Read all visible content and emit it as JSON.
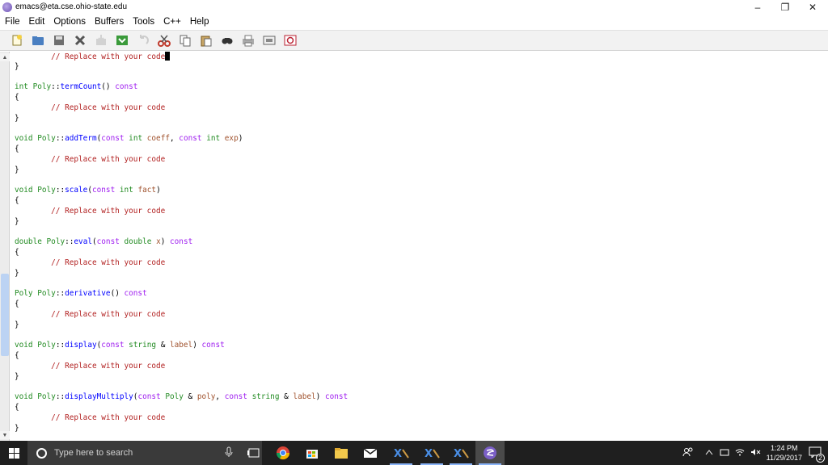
{
  "window": {
    "title": "emacs@eta.cse.ohio-state.edu",
    "minimize_label": "–",
    "restore_label": "❐",
    "close_label": "✕"
  },
  "menu": [
    "File",
    "Edit",
    "Options",
    "Buffers",
    "Tools",
    "C++",
    "Help"
  ],
  "toolbar_icons": [
    "new-file-icon",
    "open-folder-icon",
    "save-icon",
    "close-icon",
    "save-as-icon",
    "dired-icon",
    "undo-icon",
    "cut-icon",
    "copy-icon",
    "paste-icon",
    "search-icon",
    "print-icon",
    "preferences-icon",
    "help-icon"
  ],
  "editor": {
    "lines": [
      [
        {
          "t": "        "
        },
        {
          "t": "// Replace with your code",
          "c": "cm"
        },
        {
          "cursor": true
        }
      ],
      [
        {
          "t": "}"
        }
      ],
      [
        {
          "t": ""
        }
      ],
      [
        {
          "t": "int",
          "c": "ty"
        },
        {
          "t": " "
        },
        {
          "t": "Poly",
          "c": "cl"
        },
        {
          "t": "::"
        },
        {
          "t": "termCount",
          "c": "fn"
        },
        {
          "t": "() "
        },
        {
          "t": "const",
          "c": "kw"
        }
      ],
      [
        {
          "t": "{"
        }
      ],
      [
        {
          "t": "        "
        },
        {
          "t": "// Replace with your code",
          "c": "cm"
        }
      ],
      [
        {
          "t": "}"
        }
      ],
      [
        {
          "t": ""
        }
      ],
      [
        {
          "t": "void",
          "c": "ty"
        },
        {
          "t": " "
        },
        {
          "t": "Poly",
          "c": "cl"
        },
        {
          "t": "::"
        },
        {
          "t": "addTerm",
          "c": "fn"
        },
        {
          "t": "("
        },
        {
          "t": "const",
          "c": "kw"
        },
        {
          "t": " "
        },
        {
          "t": "int",
          "c": "ty"
        },
        {
          "t": " "
        },
        {
          "t": "coeff",
          "c": "vr"
        },
        {
          "t": ", "
        },
        {
          "t": "const",
          "c": "kw"
        },
        {
          "t": " "
        },
        {
          "t": "int",
          "c": "ty"
        },
        {
          "t": " "
        },
        {
          "t": "exp",
          "c": "vr"
        },
        {
          "t": ")"
        }
      ],
      [
        {
          "t": "{"
        }
      ],
      [
        {
          "t": "        "
        },
        {
          "t": "// Replace with your code",
          "c": "cm"
        }
      ],
      [
        {
          "t": "}"
        }
      ],
      [
        {
          "t": ""
        }
      ],
      [
        {
          "t": "void",
          "c": "ty"
        },
        {
          "t": " "
        },
        {
          "t": "Poly",
          "c": "cl"
        },
        {
          "t": "::"
        },
        {
          "t": "scale",
          "c": "fn"
        },
        {
          "t": "("
        },
        {
          "t": "const",
          "c": "kw"
        },
        {
          "t": " "
        },
        {
          "t": "int",
          "c": "ty"
        },
        {
          "t": " "
        },
        {
          "t": "fact",
          "c": "vr"
        },
        {
          "t": ")"
        }
      ],
      [
        {
          "t": "{"
        }
      ],
      [
        {
          "t": "        "
        },
        {
          "t": "// Replace with your code",
          "c": "cm"
        }
      ],
      [
        {
          "t": "}"
        }
      ],
      [
        {
          "t": ""
        }
      ],
      [
        {
          "t": "double",
          "c": "ty"
        },
        {
          "t": " "
        },
        {
          "t": "Poly",
          "c": "cl"
        },
        {
          "t": "::"
        },
        {
          "t": "eval",
          "c": "fn"
        },
        {
          "t": "("
        },
        {
          "t": "const",
          "c": "kw"
        },
        {
          "t": " "
        },
        {
          "t": "double",
          "c": "ty"
        },
        {
          "t": " "
        },
        {
          "t": "x",
          "c": "vr"
        },
        {
          "t": ") "
        },
        {
          "t": "const",
          "c": "kw"
        }
      ],
      [
        {
          "t": "{"
        }
      ],
      [
        {
          "t": "        "
        },
        {
          "t": "// Replace with your code",
          "c": "cm"
        }
      ],
      [
        {
          "t": "}"
        }
      ],
      [
        {
          "t": ""
        }
      ],
      [
        {
          "t": "Poly",
          "c": "cl"
        },
        {
          "t": " "
        },
        {
          "t": "Poly",
          "c": "cl"
        },
        {
          "t": "::"
        },
        {
          "t": "derivative",
          "c": "fn"
        },
        {
          "t": "() "
        },
        {
          "t": "const",
          "c": "kw"
        }
      ],
      [
        {
          "t": "{"
        }
      ],
      [
        {
          "t": "        "
        },
        {
          "t": "// Replace with your code",
          "c": "cm"
        }
      ],
      [
        {
          "t": "}"
        }
      ],
      [
        {
          "t": ""
        }
      ],
      [
        {
          "t": "void",
          "c": "ty"
        },
        {
          "t": " "
        },
        {
          "t": "Poly",
          "c": "cl"
        },
        {
          "t": "::"
        },
        {
          "t": "display",
          "c": "fn"
        },
        {
          "t": "("
        },
        {
          "t": "const",
          "c": "kw"
        },
        {
          "t": " "
        },
        {
          "t": "string",
          "c": "ty"
        },
        {
          "t": " & "
        },
        {
          "t": "label",
          "c": "vr"
        },
        {
          "t": ") "
        },
        {
          "t": "const",
          "c": "kw"
        }
      ],
      [
        {
          "t": "{"
        }
      ],
      [
        {
          "t": "        "
        },
        {
          "t": "// Replace with your code",
          "c": "cm"
        }
      ],
      [
        {
          "t": "}"
        }
      ],
      [
        {
          "t": ""
        }
      ],
      [
        {
          "t": "void",
          "c": "ty"
        },
        {
          "t": " "
        },
        {
          "t": "Poly",
          "c": "cl"
        },
        {
          "t": "::"
        },
        {
          "t": "displayMultiply",
          "c": "fn"
        },
        {
          "t": "("
        },
        {
          "t": "const",
          "c": "kw"
        },
        {
          "t": " "
        },
        {
          "t": "Poly",
          "c": "cl"
        },
        {
          "t": " & "
        },
        {
          "t": "poly",
          "c": "vr"
        },
        {
          "t": ", "
        },
        {
          "t": "const",
          "c": "kw"
        },
        {
          "t": " "
        },
        {
          "t": "string",
          "c": "ty"
        },
        {
          "t": " & "
        },
        {
          "t": "label",
          "c": "vr"
        },
        {
          "t": ") "
        },
        {
          "t": "const",
          "c": "kw"
        }
      ],
      [
        {
          "t": "{"
        }
      ],
      [
        {
          "t": "        "
        },
        {
          "t": "// Replace with your code",
          "c": "cm"
        }
      ],
      [
        {
          "t": "}"
        }
      ]
    ]
  },
  "taskbar": {
    "search_placeholder": "Type here to search",
    "time": "1:24 PM",
    "date": "11/29/2017",
    "notification_count": "2"
  },
  "colors": {
    "comment": "#b22222",
    "keyword": "#a020f0",
    "type": "#228b22",
    "function": "#0000ff",
    "variable": "#a0522d",
    "taskbar": "#1f1f1f"
  }
}
